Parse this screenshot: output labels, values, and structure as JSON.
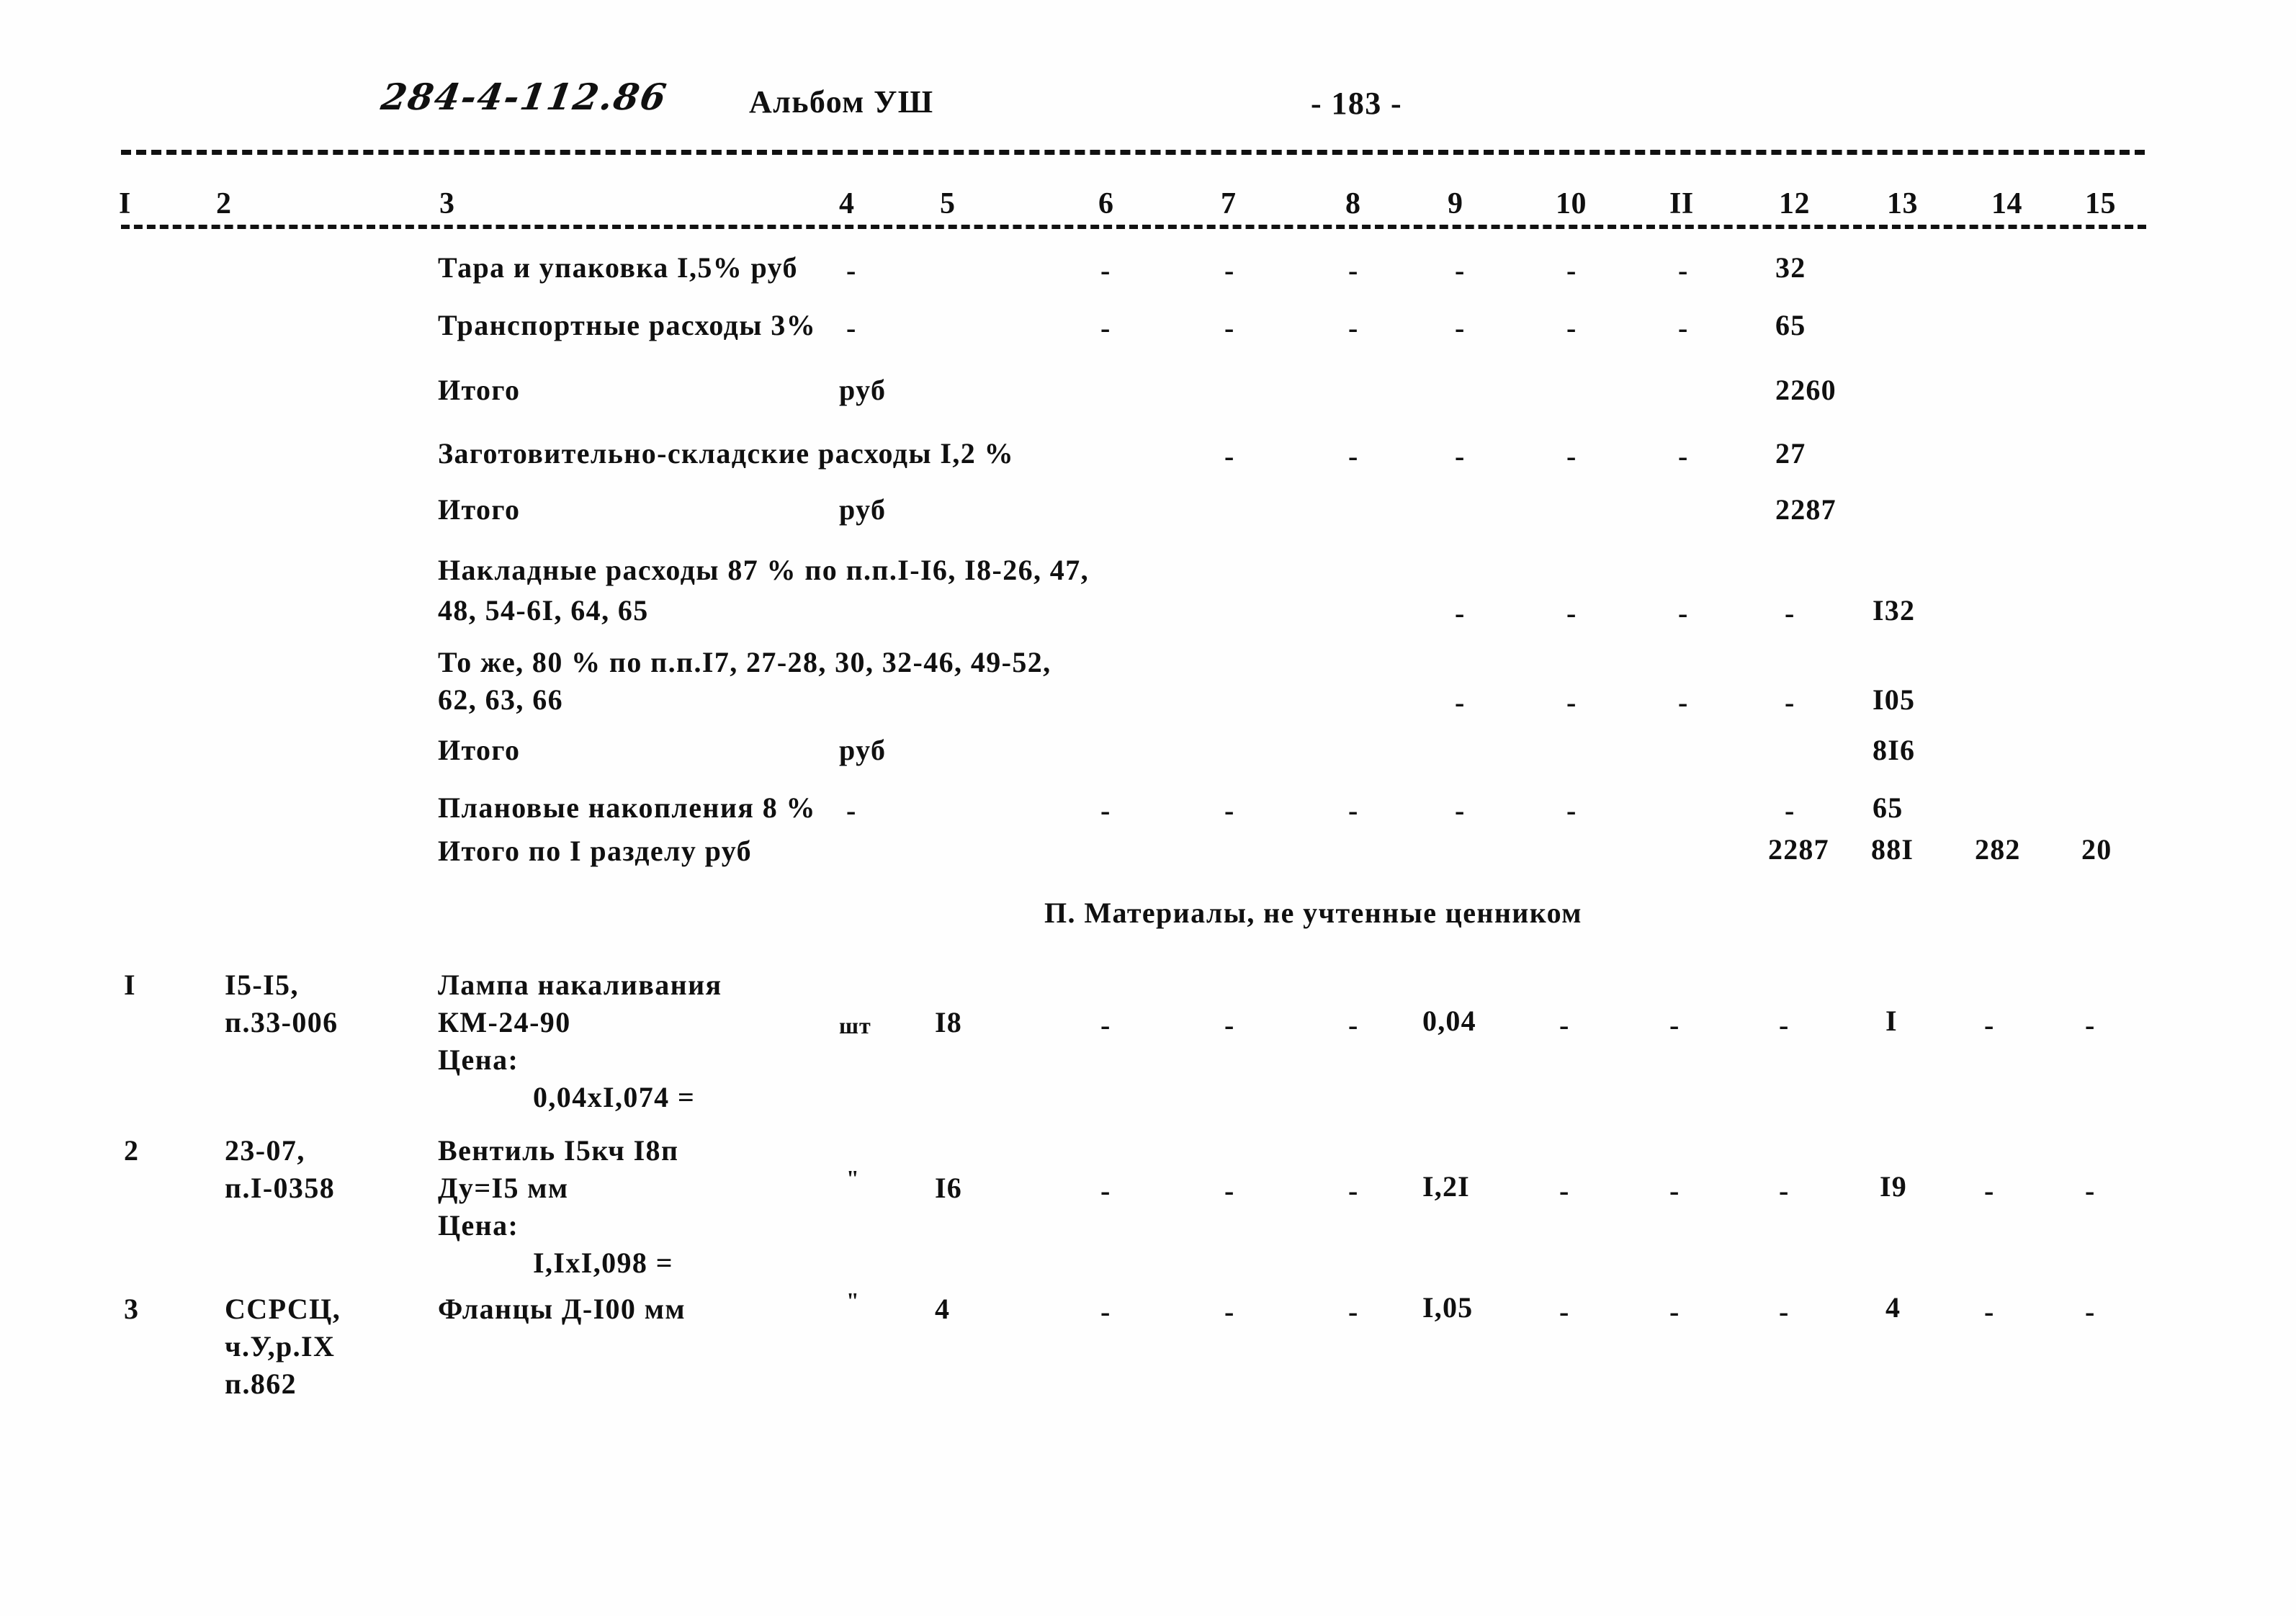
{
  "header": {
    "doc_code": "284-4-112.86",
    "album": "Альбом УШ",
    "page_number": "- 183 -"
  },
  "table": {
    "column_numbers": [
      "I",
      "2",
      "3",
      "4",
      "5",
      "6",
      "7",
      "8",
      "9",
      "10",
      "II",
      "12",
      "13",
      "14",
      "15"
    ],
    "dash": "-",
    "summary_rows": [
      {
        "label": "Тара и упаковка I,5% руб",
        "unit": "-",
        "dashes": [
          "-",
          "-",
          "-",
          "-",
          "-",
          "-",
          "-"
        ],
        "c12": "32"
      },
      {
        "label": "Транспортные расходы 3%",
        "unit": "-",
        "dashes": [
          "-",
          "-",
          "-",
          "-",
          "-",
          "-",
          "-"
        ],
        "c12": "65"
      },
      {
        "label": "Итого",
        "unit": "руб",
        "c12": "2260"
      },
      {
        "label": "Заготовительно-складские расходы I,2 %",
        "unit": "-",
        "dashes": [
          "-",
          "-",
          "-",
          "-",
          "-",
          "-"
        ],
        "c12": "27"
      },
      {
        "label": "Итого",
        "unit": "руб",
        "c12": "2287"
      },
      {
        "label_line1": "Накладные расходы 87 % по п.п.I-I6, I8-26, 47,",
        "label_line2": "48, 54-6I, 64, 65",
        "dashes": [
          "-",
          "-",
          "-",
          "-"
        ],
        "c13": "I32"
      },
      {
        "label_line1": "То же, 80 % по п.п.I7, 27-28, 30, 32-46, 49-52,",
        "label_line2": "62, 63, 66",
        "dashes": [
          "-",
          "-",
          "-",
          "-"
        ],
        "c13": "I05"
      },
      {
        "label": "Итого",
        "unit": "руб",
        "c13": "8I6"
      },
      {
        "label": "Плановые накопления 8 %",
        "unit": "-",
        "dashes": [
          "-",
          "-",
          "-",
          "-",
          "-",
          "-",
          "-"
        ],
        "c13": "65"
      },
      {
        "label": "Итого по I разделу руб",
        "c12": "2287",
        "c13": "88I",
        "c14": "282",
        "c15": "20"
      }
    ],
    "section_heading": "П. Материалы, не учтенные ценником",
    "material_rows": [
      {
        "no": "I",
        "code_line1": "I5-I5,",
        "code_line2": "п.33-006",
        "name_line1": "Лампа накаливания",
        "name_line2": "КМ-24-90",
        "price_label": "Цена:",
        "price_calc": "0,04хI,074 =",
        "unit": "шт",
        "qty": "I8",
        "c6": "-",
        "c7": "-",
        "c8": "-",
        "c9": "0,04",
        "c10": "-",
        "c11": "-",
        "c12": "-",
        "c13": "I",
        "c14": "-",
        "c15": "-"
      },
      {
        "no": "2",
        "code_line1": "23-07,",
        "code_line2": "п.I-0358",
        "name_line1": "Вентиль I5кч I8п",
        "name_line2": "Ду=I5 мм",
        "price_label": "Цена:",
        "price_calc": "I,IхI,098 =",
        "unit": "\"",
        "qty": "I6",
        "c6": "-",
        "c7": "-",
        "c8": "-",
        "c9": "I,2I",
        "c10": "-",
        "c11": "-",
        "c12": "-",
        "c13": "I9",
        "c14": "-",
        "c15": "-"
      },
      {
        "no": "3",
        "code_line1": "ССРСЦ,",
        "code_line2": "ч.У,р.IX",
        "code_line3": "п.862",
        "name_line1": "Фланцы Д-I00 мм",
        "unit": "\"",
        "qty": "4",
        "c6": "-",
        "c7": "-",
        "c8": "-",
        "c9": "I,05",
        "c10": "-",
        "c11": "-",
        "c12": "-",
        "c13": "4",
        "c14": "-",
        "c15": "-"
      }
    ]
  }
}
